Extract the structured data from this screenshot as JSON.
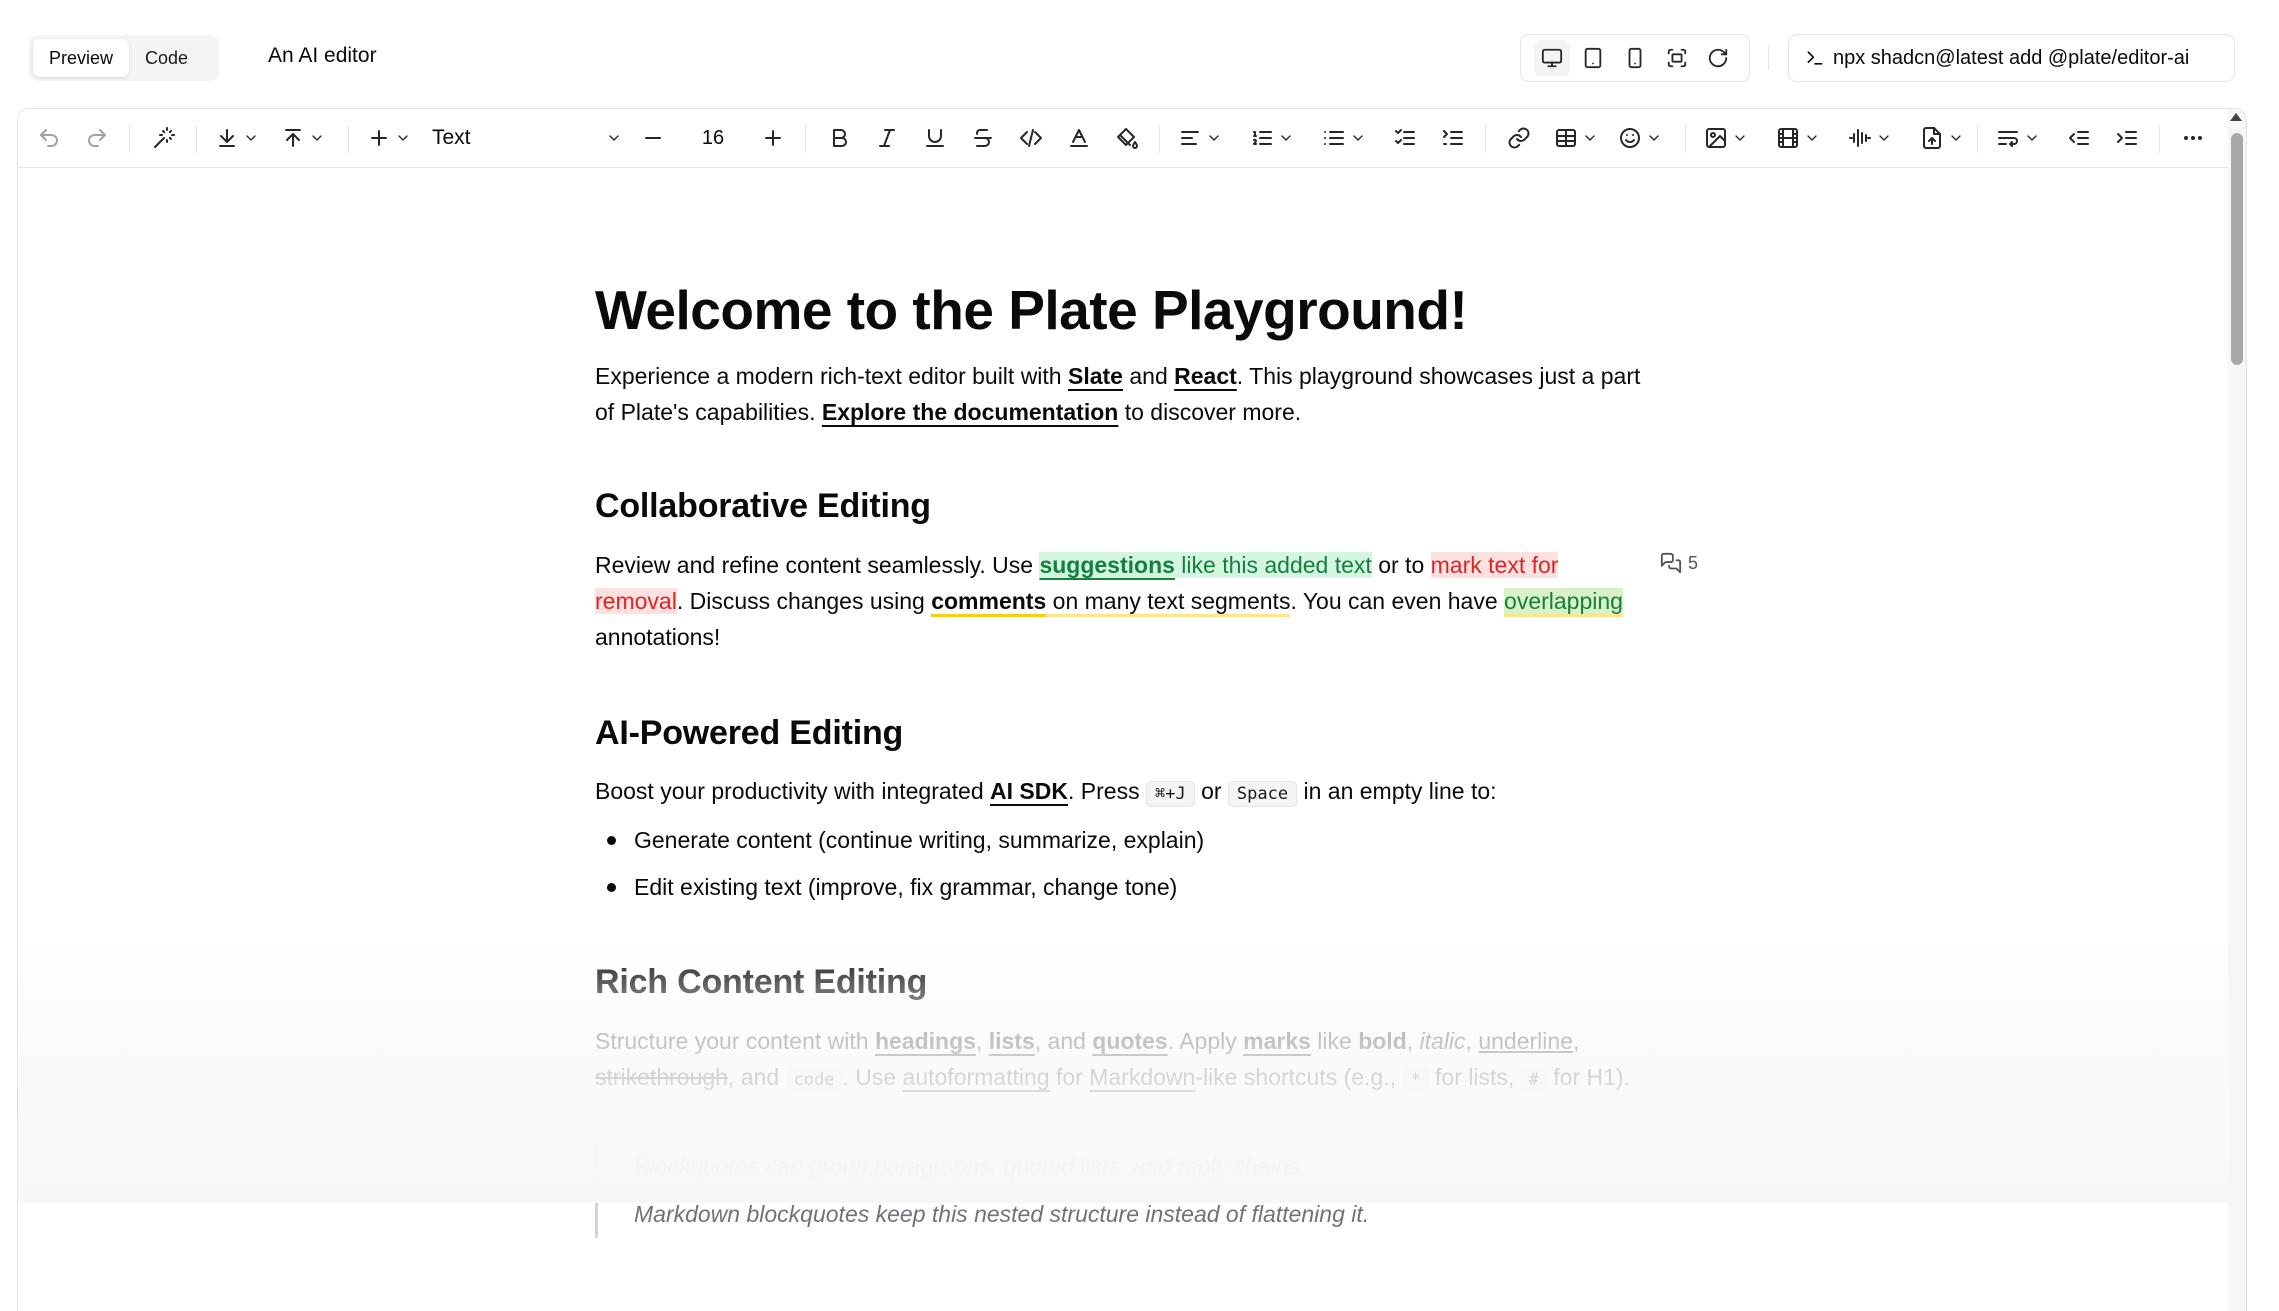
{
  "header": {
    "tabs": [
      {
        "label": "Preview",
        "active": true
      },
      {
        "label": "Code",
        "active": false
      }
    ],
    "title": "An AI editor",
    "device_icons": [
      "monitor-icon",
      "tablet-icon",
      "phone-icon",
      "fullscreen-icon",
      "refresh-icon"
    ],
    "command": "npx shadcn@latest add @plate/editor-ai"
  },
  "toolbar": {
    "block_type": "Text",
    "font_size": "16"
  },
  "document": {
    "title": "Welcome to the Plate Playground!",
    "intro": {
      "t1": "Experience a modern rich-text editor built with ",
      "l1": "Slate",
      "t2": " and ",
      "l2": "React",
      "t3": ". This playground showcases just a part of Plate's capabilities. ",
      "l3": "Explore the documentation",
      "t4": " to discover more."
    },
    "collab": {
      "heading": "Collaborative Editing",
      "t1": "Review and refine content seamlessly. Use ",
      "s1": "suggestions",
      "s2": " like this added text",
      "t2": " or to ",
      "r1": "mark text for removal",
      "t3": ". Discuss changes using ",
      "c1": "comments",
      "c2": " on many text segments",
      "t4": ". You can even have ",
      "o1": "overlapping",
      "t5": " annotations!",
      "comment_count": "5"
    },
    "ai": {
      "heading": "AI-Powered Editing",
      "t1": "Boost your productivity with integrated ",
      "l1": "AI SDK",
      "t2": ". Press ",
      "k1": "⌘+J",
      "t3": " or ",
      "k2": "Space",
      "t4": " in an empty line to:",
      "bullets": [
        "Generate content (continue writing, summarize, explain)",
        "Edit existing text (improve, fix grammar, change tone)"
      ]
    },
    "rich": {
      "heading": "Rich Content Editing",
      "t1": "Structure your content with ",
      "l1": "headings",
      "t2": ", ",
      "l2": "lists",
      "t3": ", and ",
      "l3": "quotes",
      "t4": ". Apply ",
      "l4": "marks",
      "t5": " like ",
      "b1": "bold",
      "t6": ", ",
      "i1": "italic",
      "t7": ", ",
      "u1": "underline",
      "t8": ",",
      "s1": "strikethrough",
      "t9": ", and ",
      "c1": "code",
      "t10": ". Use ",
      "l5": "autoformatting",
      "t11": " for ",
      "l6": "Markdown",
      "t12": "-like shortcuts (e.g., ",
      "c2": "*",
      "t13": " for lists, ",
      "c3": "#",
      "t14": "for H1).",
      "quotes": [
        "Blockquotes can group paragraphs, quoted lists, and reply chains.",
        "Markdown blockquotes keep this nested structure instead of flattening it."
      ]
    }
  }
}
